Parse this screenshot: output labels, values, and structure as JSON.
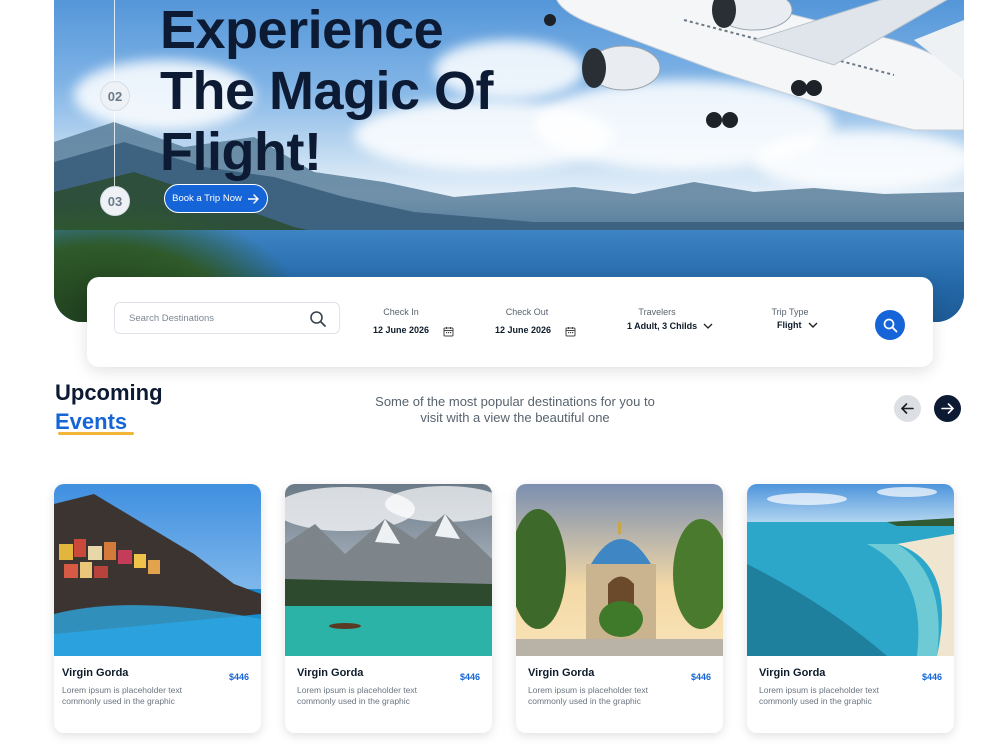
{
  "hero": {
    "title_line1": "Experience",
    "title_line2": "The Magic Of",
    "title_line3": "Flight!",
    "steps": [
      "02",
      "03"
    ],
    "book_button": "Book a Trip Now"
  },
  "search": {
    "placeholder": "Search Destinations",
    "check_in_label": "Check In",
    "check_in_value": "12 June 2026",
    "check_out_label": "Check Out",
    "check_out_value": "12 June 2026",
    "travelers_label": "Travelers",
    "travelers_value": "1 Adult, 3 Childs",
    "trip_type_label": "Trip Type",
    "trip_type_value": "Flight"
  },
  "upcoming": {
    "title_line1": "Upcoming",
    "title_line2": "Events",
    "subtitle": "Some of the most popular destinations for you to visit with a view the beautiful one"
  },
  "cards": [
    {
      "title": "Virgin Gorda",
      "price": "$446",
      "desc": "Lorem ipsum is placeholder text commonly used in the graphic"
    },
    {
      "title": "Virgin Gorda",
      "price": "$446",
      "desc": "Lorem ipsum is placeholder text commonly used in the graphic"
    },
    {
      "title": "Virgin Gorda",
      "price": "$446",
      "desc": "Lorem ipsum is placeholder text commonly used in the graphic"
    },
    {
      "title": "Virgin Gorda",
      "price": "$446",
      "desc": "Lorem ipsum is placeholder text commonly used in the graphic"
    }
  ],
  "colors": {
    "accent": "#1565d8",
    "dark": "#0c1a33",
    "underline": "#f2b53a"
  },
  "icons": [
    "arrow-right-icon",
    "search-icon",
    "calendar-icon",
    "chevron-down-icon",
    "arrow-left-icon",
    "airplane-icon"
  ]
}
